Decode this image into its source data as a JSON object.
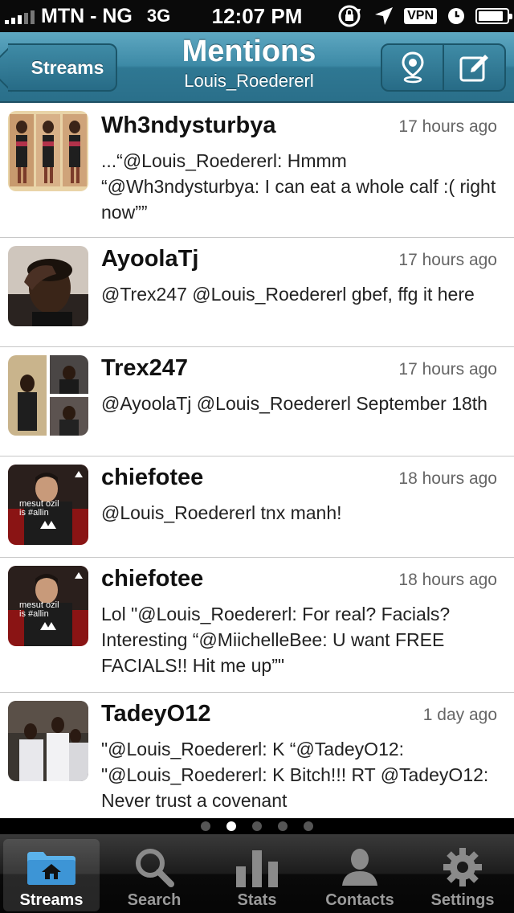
{
  "status_bar": {
    "carrier": "MTN - NG",
    "network": "3G",
    "time": "12:07 PM",
    "vpn": "VPN"
  },
  "nav": {
    "back_label": "Streams",
    "title": "Mentions",
    "subtitle": "Louis_Roedererl"
  },
  "tweets": [
    {
      "name": "Wh3ndysturbya",
      "time": "17 hours ago",
      "text": "...“@Louis_Roedererl: Hmmm “@Wh3ndysturbya: I can eat a whole calf :( right now””"
    },
    {
      "name": "AyoolaTj",
      "time": "17 hours ago",
      "text": "@Trex247 @Louis_Roedererl gbef, ffg it here"
    },
    {
      "name": "Trex247",
      "time": "17 hours ago",
      "text": "@AyoolaTj @Louis_Roedererl September 18th"
    },
    {
      "name": "chiefotee",
      "time": "18 hours ago",
      "text": "@Louis_Roedererl tnx manh!",
      "avatar_caption": "mesut ozil is #allin"
    },
    {
      "name": "chiefotee",
      "time": "18 hours ago",
      "text": "Lol \"@Louis_Roedererl: For real? Facials? Interesting “@MiichelleBee: U want FREE FACIALS!! Hit me up”\"",
      "avatar_caption": "mesut ozil is #allin"
    },
    {
      "name": "TadeyO12",
      "time": "1 day ago",
      "text": "\"@Louis_Roedererl: K “@TadeyO12: \"@Louis_Roedererl: K Bitch!!! RT @TadeyO12: Never trust a covenant"
    }
  ],
  "tabs": [
    {
      "label": "Streams",
      "icon": "folder-home-icon",
      "active": true
    },
    {
      "label": "Search",
      "icon": "magnifier-icon"
    },
    {
      "label": "Stats",
      "icon": "bar-chart-icon"
    },
    {
      "label": "Contacts",
      "icon": "person-icon"
    },
    {
      "label": "Settings",
      "icon": "gear-icon"
    }
  ],
  "colors": {
    "navbar": "#3d8aa6",
    "accent_folder": "#4aa3e0"
  }
}
